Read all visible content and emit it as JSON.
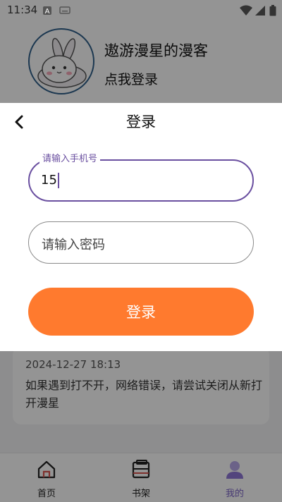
{
  "status_bar": {
    "time": "11:34",
    "icons": [
      "notification-a-icon",
      "keyboard-icon",
      "wifi-icon",
      "signal-icon",
      "battery-icon"
    ]
  },
  "profile": {
    "nickname": "遨游漫星的漫客",
    "login_prompt": "点我登录",
    "avatar_icon": "bunny-avatar-icon"
  },
  "login_sheet": {
    "title": "登录",
    "back_icon": "chevron-left-icon",
    "phone_field": {
      "label": "请输入手机号",
      "value": "15"
    },
    "password_field": {
      "placeholder": "请输入密码",
      "value": ""
    },
    "submit_label": "登录"
  },
  "notice": {
    "timestamp": "2024-12-27 18:13",
    "text": "如果遇到打不开，网络错误，请尝试关闭从新打开漫星"
  },
  "bottom_nav": {
    "items": [
      {
        "label": "首页",
        "icon": "home-icon",
        "active": false
      },
      {
        "label": "书架",
        "icon": "bookshelf-icon",
        "active": false
      },
      {
        "label": "我的",
        "icon": "profile-icon",
        "active": true
      }
    ]
  },
  "colors": {
    "accent_purple": "#6a4fa0",
    "login_button": "#ff7a2e",
    "nav_active": "#7a63c7",
    "overlay": "rgba(0,0,0,0.42)"
  }
}
